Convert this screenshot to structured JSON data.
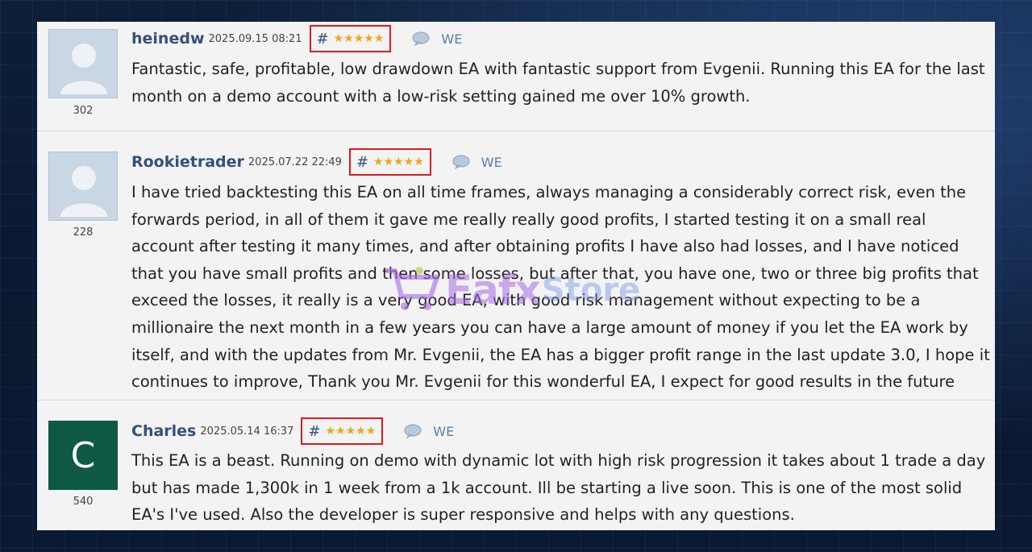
{
  "reviews": [
    {
      "author": "heinedw",
      "date": "2025.09.15 08:21",
      "hash": "#",
      "stars": "★★★★★",
      "rating": 5,
      "reply_label": "WE",
      "count": "302",
      "avatar": "default-user-icon",
      "text": "Fantastic, safe, profitable, low drawdown EA with fantastic support from Evgenii. Running this EA for the last month on a demo account with a low-risk setting gained me over 10% growth."
    },
    {
      "author": "Rookietrader",
      "date": "2025.07.22 22:49",
      "hash": "#",
      "stars": "★★★★★",
      "rating": 5,
      "reply_label": "WE",
      "count": "228",
      "avatar": "default-user-icon",
      "text": "I have tried backtesting this EA on all time frames, always managing a considerably correct risk, even the forwards period, in all of them it gave me really really good profits, I started testing it on a small real account after testing it many times, and after obtaining profits I have also had losses, and I have noticed that you have small profits and then some losses, but after that, you have one, two or three big profits that exceed the losses, it really is a very good EA, with good risk management without expecting to be a millionaire the next month in a few years you can have a large amount of money if you let the EA work by itself, and with the updates from Mr. Evgenii, the EA has a bigger profit range in the last update 3.0, I hope it continues to improve, Thank you Mr. Evgenii for this wonderful EA, I expect for good results in the future"
    },
    {
      "author": "Charles",
      "date": "2025.05.14 16:37",
      "hash": "#",
      "stars": "★★★★★",
      "rating": 5,
      "reply_label": "WE",
      "count": "540",
      "avatar_letter": "C",
      "avatar_color": "#0f5a45",
      "text": "This EA is a beast. Running on demo with dynamic lot with high risk progression it takes about 1 trade a day but has made 1,300k in 1 week from a 1k account. Ill be starting a live soon. This is one of the most solid EA's I've used. Also the developer is super responsive and helps with any questions."
    }
  ],
  "watermark": {
    "text": "Eafx",
    "text2": "Store"
  },
  "colors": {
    "accent_link": "#33507c",
    "star": "#f0a515",
    "highlight_box": "#e0191f"
  }
}
